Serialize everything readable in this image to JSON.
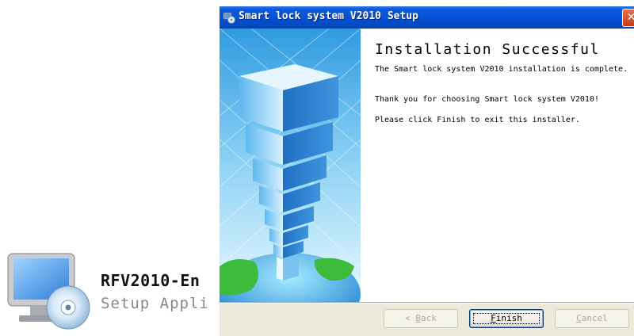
{
  "desktop_file": {
    "name": "RFV2010-En",
    "type": "Setup Appli"
  },
  "window": {
    "title": "Smart lock system V2010 Setup",
    "close_label": "✕"
  },
  "content": {
    "heading": "Installation Successful",
    "message_complete": "The Smart lock system V2010  installation is complete.",
    "message_thanks": "Thank you for choosing Smart lock system V2010!",
    "message_exit": "Please click Finish to exit this installer."
  },
  "buttons": {
    "back": {
      "mnemonic": "< ",
      "underline": "B",
      "rest": "ack",
      "enabled": false
    },
    "finish": {
      "underline": "F",
      "rest": "inish",
      "enabled": true
    },
    "cancel": {
      "underline": "C",
      "rest": "ancel",
      "enabled": false
    }
  },
  "icons": {
    "title": "installer-icon",
    "banner": "glass-tower-on-globe-graphic",
    "file": "computer-with-cd-icon"
  }
}
